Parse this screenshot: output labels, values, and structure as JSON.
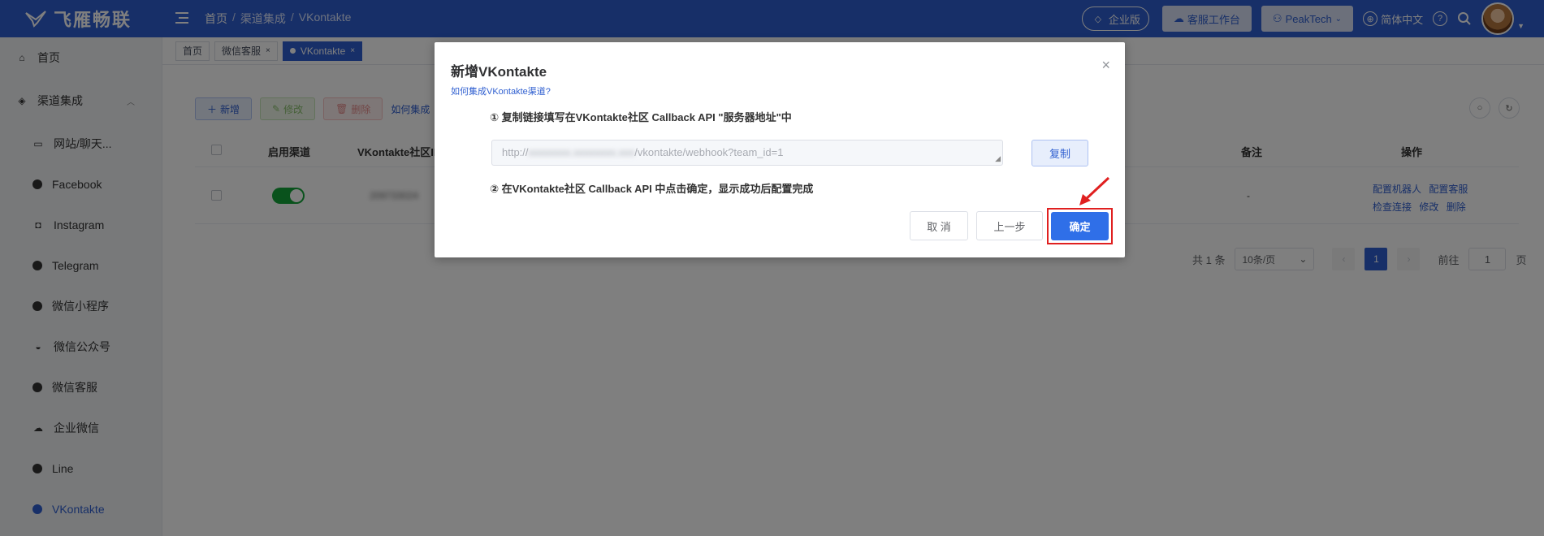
{
  "brand": {
    "name": "飞雁畅联"
  },
  "breadcrumb": [
    "首页",
    "渠道集成",
    "VKontakte"
  ],
  "topbar": {
    "edition": "企业版",
    "workspace": "客服工作台",
    "team": "PeakTech",
    "language": "简体中文"
  },
  "sidebar": {
    "home": "首页",
    "group": "渠道集成",
    "items": [
      "网站/聊天...",
      "Facebook",
      "Instagram",
      "Telegram",
      "微信小程序",
      "微信公众号",
      "微信客服",
      "企业微信",
      "Line",
      "VKontakte"
    ]
  },
  "tabs": [
    {
      "label": "首页"
    },
    {
      "label": "微信客服"
    },
    {
      "label": "VKontakte"
    }
  ],
  "toolbar": {
    "add": "新增",
    "edit": "修改",
    "delete": "删除",
    "help": "如何集成"
  },
  "table": {
    "headers": {
      "enabled": "启用渠道",
      "community_id": "VKontakte社区ID",
      "remark": "备注",
      "actions": "操作"
    },
    "rows": [
      {
        "community_id": "209733024",
        "remark": "-",
        "actions": [
          "配置机器人",
          "配置客服",
          "检查连接",
          "修改",
          "删除"
        ]
      }
    ]
  },
  "pagination": {
    "total": "共 1 条",
    "page_size": "10条/页",
    "current": "1",
    "goto_prefix": "前往",
    "goto_value": "1",
    "goto_suffix": "页"
  },
  "modal": {
    "title": "新增VKontakte",
    "help_link": "如何集成VKontakte渠道?",
    "step1": "① 复制链接填写在VKontakte社区 Callback API \"服务器地址\"中",
    "url_prefix": "http://",
    "url_hidden": "xxxxxxxx.xxxxxxxx.xxx",
    "url_suffix": "/vkontakte/webhook?team_id=1",
    "copy": "复制",
    "step2": "② 在VKontakte社区 Callback API 中点击确定，显示成功后配置完成",
    "cancel": "取 消",
    "prev": "上一步",
    "confirm": "确定"
  }
}
